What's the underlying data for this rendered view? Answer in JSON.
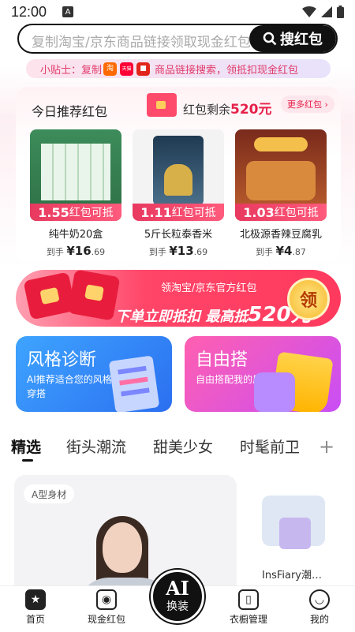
{
  "status": {
    "time": "12:00",
    "notif": "A"
  },
  "search": {
    "placeholder": "复制淘宝/京东商品链接领取现金红包",
    "button": "搜红包"
  },
  "tip": {
    "label": "小贴士：复制",
    "app1": "淘",
    "app2": "天猫",
    "rest": "商品链接搜索，领抵扣现金红包"
  },
  "recommend": {
    "title": "今日推荐红包",
    "remain_label": "红包剩余",
    "remain_value": "520元",
    "more": "更多红包 ›",
    "products": [
      {
        "tag_value": "1.55",
        "tag_text": "红包可抵",
        "name": "纯牛奶20盒",
        "price_prefix": "到手",
        "currency": "¥",
        "price_int": "16",
        "price_dec": ".69"
      },
      {
        "tag_value": "1.11",
        "tag_text": "红包可抵",
        "name": "5斤长粒泰香米",
        "price_prefix": "到手",
        "currency": "¥",
        "price_int": "13",
        "price_dec": ".69"
      },
      {
        "tag_value": "1.03",
        "tag_text": "红包可抵",
        "name": "北极源香辣豆腐乳",
        "price_prefix": "到手",
        "currency": "¥",
        "price_int": "4",
        "price_dec": ".87"
      }
    ]
  },
  "banner": {
    "line1": "领淘宝/京东官方红包",
    "line2a": "下单立即抵扣 最高抵",
    "line2b": "520元",
    "coin": "领"
  },
  "features": [
    {
      "title": "风格诊断",
      "sub": "AI推荐适合您的风格穿搭"
    },
    {
      "title": "自由搭",
      "sub": "自由搭配我的风格"
    }
  ],
  "tabs": [
    "精选",
    "街头潮流",
    "甜美少女",
    "时髦前卫"
  ],
  "plus": "+",
  "feed": {
    "badge": "A型身材",
    "cloth_name": "InsFiary潮…"
  },
  "nav": [
    {
      "label": "首页"
    },
    {
      "label": "现金红包"
    },
    {
      "label": "衣橱管理"
    },
    {
      "label": "我的"
    }
  ],
  "ai_button": {
    "line1": "AI",
    "line2": "换装"
  },
  "colors": {
    "accent": "#e6214a",
    "dark": "#111111"
  }
}
